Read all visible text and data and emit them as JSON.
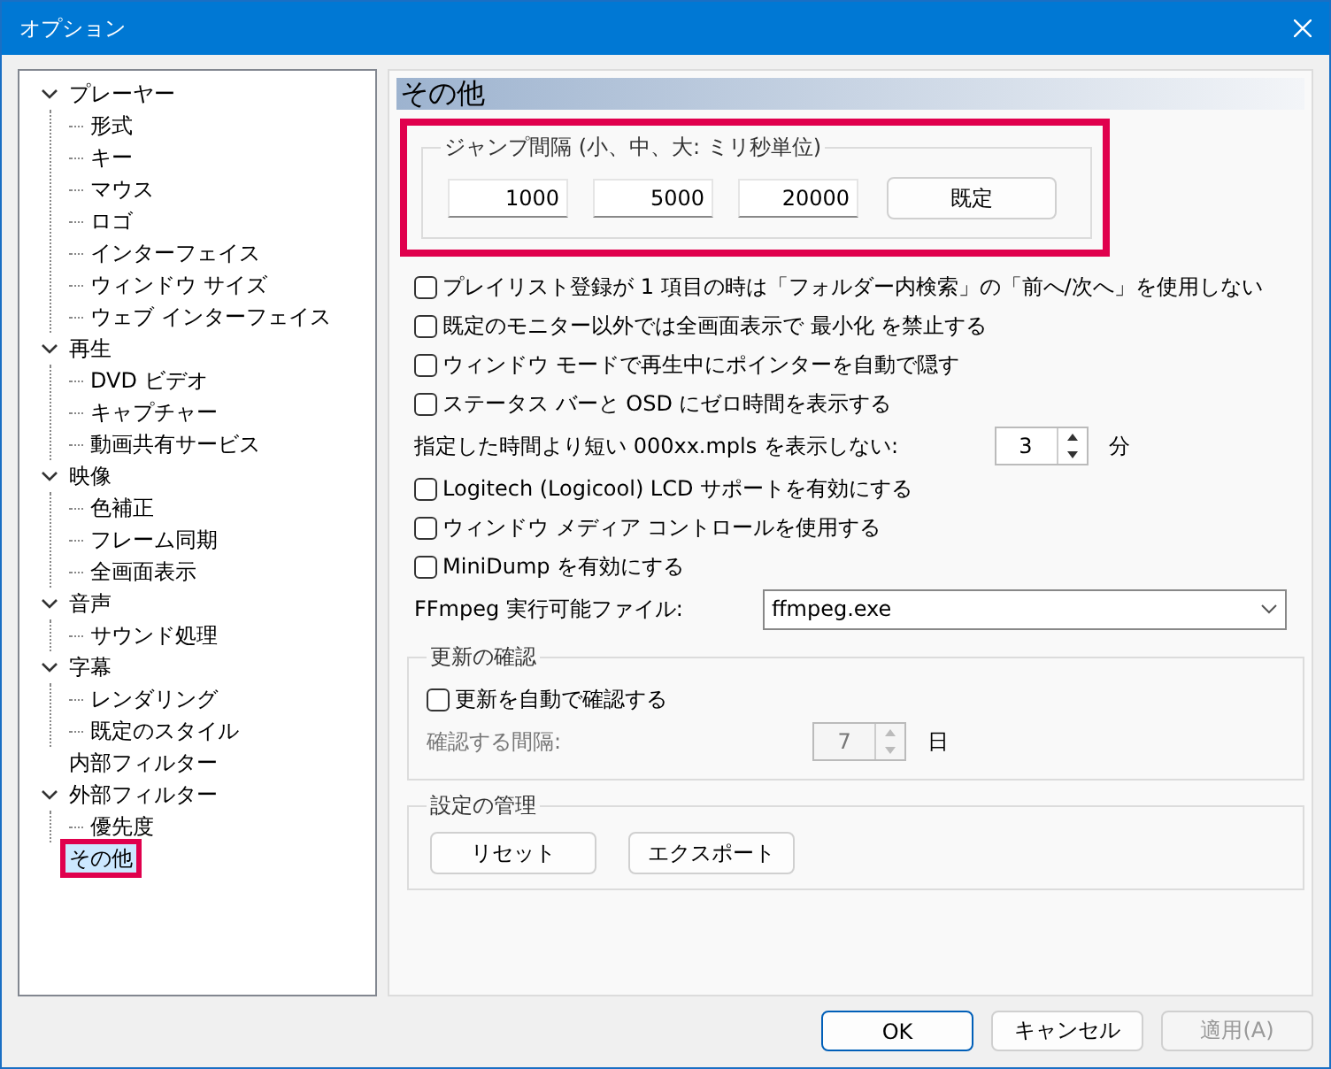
{
  "window": {
    "title": "オプション"
  },
  "tree": [
    {
      "label": "プレーヤー",
      "expanded": true,
      "selected": false,
      "children": [
        {
          "label": "形式",
          "selected": false
        },
        {
          "label": "キー",
          "selected": false
        },
        {
          "label": "マウス",
          "selected": false
        },
        {
          "label": "ロゴ",
          "selected": false
        },
        {
          "label": "インターフェイス",
          "selected": false
        },
        {
          "label": "ウィンドウ サイズ",
          "selected": false
        },
        {
          "label": "ウェブ インターフェイス",
          "selected": false
        }
      ]
    },
    {
      "label": "再生",
      "expanded": true,
      "selected": false,
      "children": [
        {
          "label": "DVD ビデオ",
          "selected": false
        },
        {
          "label": "キャプチャー",
          "selected": false
        },
        {
          "label": "動画共有サービス",
          "selected": false
        }
      ]
    },
    {
      "label": "映像",
      "expanded": true,
      "selected": false,
      "children": [
        {
          "label": "色補正",
          "selected": false
        },
        {
          "label": "フレーム同期",
          "selected": false
        },
        {
          "label": "全画面表示",
          "selected": false
        }
      ]
    },
    {
      "label": "音声",
      "expanded": true,
      "selected": false,
      "children": [
        {
          "label": "サウンド処理",
          "selected": false
        }
      ]
    },
    {
      "label": "字幕",
      "expanded": true,
      "selected": false,
      "children": [
        {
          "label": "レンダリング",
          "selected": false
        },
        {
          "label": "既定のスタイル",
          "selected": false
        }
      ]
    },
    {
      "label": "内部フィルター",
      "selected": false
    },
    {
      "label": "外部フィルター",
      "expanded": true,
      "selected": false,
      "children": [
        {
          "label": "優先度",
          "selected": false
        }
      ]
    },
    {
      "label": "その他",
      "selected": true,
      "highlighted": true
    }
  ],
  "page": {
    "title": "その他",
    "jump_group": {
      "title": "ジャンプ間隔 (小、中、大: ミリ秒単位)",
      "highlighted": true,
      "values": [
        "1000",
        "5000",
        "20000"
      ],
      "button": "既定"
    },
    "options": [
      {
        "kind": "checkbox",
        "label": "プレイリスト登録が 1 項目の時は「フォルダー内検索」の「前へ/次へ」を使用しない",
        "checked": false
      },
      {
        "kind": "checkbox",
        "label": "既定のモニター以外では全画面表示で 最小化 を禁止する",
        "checked": false
      },
      {
        "kind": "checkbox",
        "label": "ウィンドウ モードで再生中にポインターを自動で隠す",
        "checked": false
      },
      {
        "kind": "checkbox",
        "label": "ステータス バーと OSD にゼロ時間を表示する",
        "checked": false
      },
      {
        "kind": "spin",
        "label": "指定した時間より短い 000xx.mpls を表示しない:",
        "value": "3",
        "unit": "分"
      },
      {
        "kind": "checkbox",
        "label": "Logitech (Logicool) LCD サポートを有効にする",
        "checked": false
      },
      {
        "kind": "checkbox",
        "label": "ウィンドウ メディア コントロールを使用する",
        "checked": false
      },
      {
        "kind": "checkbox",
        "label": "MiniDump を有効にする",
        "checked": false
      },
      {
        "kind": "combo",
        "label": "FFmpeg 実行可能ファイル:",
        "value": "ffmpeg.exe"
      }
    ],
    "update_group": {
      "title": "更新の確認",
      "checkbox": {
        "label": "更新を自動で確認する",
        "checked": false
      },
      "interval": {
        "label": "確認する間隔:",
        "value": "7",
        "unit": "日",
        "disabled": true
      }
    },
    "manage_group": {
      "title": "設定の管理",
      "buttons": [
        "リセット",
        "エクスポート"
      ]
    }
  },
  "buttons": [
    {
      "label": "OK",
      "disabled": false,
      "default": true
    },
    {
      "label": "キャンセル",
      "disabled": false,
      "default": false
    },
    {
      "label": "適用(A)",
      "disabled": true,
      "default": false
    }
  ]
}
